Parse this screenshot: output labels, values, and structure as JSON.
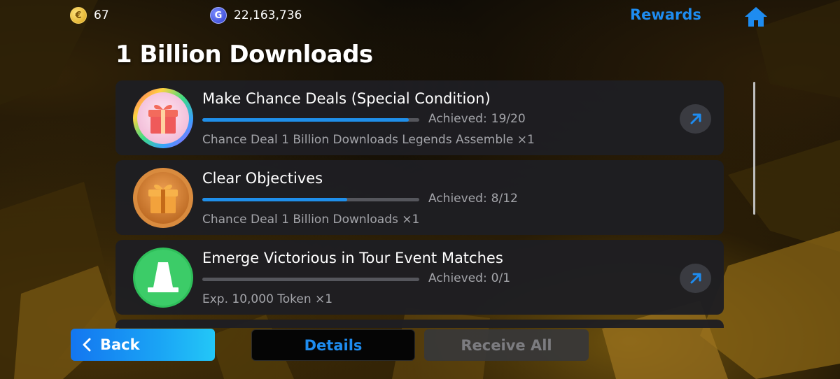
{
  "topbar": {
    "coins": {
      "value": "67",
      "icon": "coin-icon",
      "symbol": "€"
    },
    "gp": {
      "value": "22,163,736",
      "icon": "gp-icon",
      "symbol": "G"
    },
    "rewards_label": "Rewards",
    "home_icon": "home-icon"
  },
  "page": {
    "title": "1 Billion Downloads"
  },
  "objectives": [
    {
      "title": "Make Chance Deals (Special Condition)",
      "achieved_label": "Achieved:",
      "achieved_value": "19/20",
      "progress": 0.95,
      "reward": "Chance Deal 1 Billion Downloads Legends Assemble ×1",
      "icon": "gift-rainbow-icon",
      "has_goto": true
    },
    {
      "title": "Clear Objectives",
      "achieved_label": "Achieved:",
      "achieved_value": "8/12",
      "progress": 0.667,
      "reward": "Chance Deal 1 Billion Downloads ×1",
      "icon": "gift-bronze-icon",
      "has_goto": false
    },
    {
      "title": "Emerge Victorious in Tour Event Matches",
      "achieved_label": "Achieved:",
      "achieved_value": "0/1",
      "progress": 0,
      "reward": "Exp. 10,000 Token ×1",
      "icon": "cone-icon",
      "has_goto": true
    }
  ],
  "bottombar": {
    "back_label": "Back",
    "details_label": "Details",
    "receive_all_label": "Receive All"
  },
  "colors": {
    "accent_blue": "#1e8cf0",
    "progress_blue": "#1f8fea",
    "card_bg": "#1e1e22",
    "muted_text": "#a3a4a9"
  }
}
